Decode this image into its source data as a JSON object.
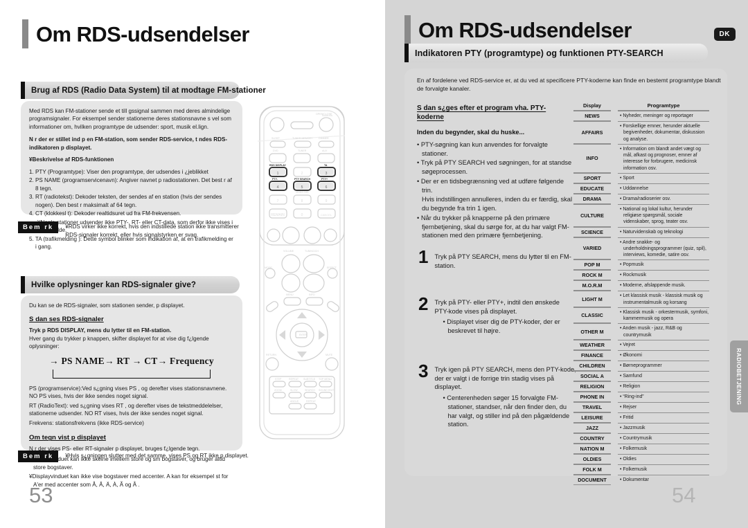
{
  "left_page": {
    "title": "Om RDS-udsendelser",
    "page_number": "53",
    "section1": {
      "heading": "Brug af RDS (Radio Data System) til at modtage FM-stationer",
      "intro": "Med RDS kan FM-stationer sende et till gssignal sammen med deres almindelige programsignaler. For eksempel sender stationerne deres stationsnavne s vel som informationer om, hvilken programtype de udsender: sport, musik el.lign.",
      "bold_note": "N r der er stillet ind p  en FM-station, som sender RDS-service, t ndes RDS-indikatoren p  displayet.",
      "sub_heading": "¥Beskrivelse af RDS-funktionen",
      "items": [
        "1. PTY (Programtype): Viser den programtype, der udsendes i ¿jeblikket",
        "2. PS NAME (programservicenavn): Angiver navnet p  radiostationen. Det best r af 8 tegn.",
        "3. RT (radiotekst): Dekoder teksten, der sendes af en station (hvis der sendes nogen). Den best r maksimalt af 64 tegn.",
        "4. CT (klokkesl t): Dekoder realtidsuret ud fra FM-frekvensen.",
        "¥Nogle stationer udsender ikke PTY-, RT- eller CT-data, som derfor ikke vises i alle tilf lde.",
        "5. TA (trafikmelding ): Dette symbol blinker som indikation af, at en trafikmelding er i gang."
      ],
      "note_badge": "Bem rk",
      "note_text": "¥RDS virker ikke korrekt, hvis den indstillede station ikke transmitterer RDS-signaler korrekt, eller hvis signalstyrken er svag."
    },
    "section2": {
      "heading": "Hvilke oplysninger kan RDS-signaler give?",
      "intro": "Du kan se de RDS-signaler, som stationen sender, p  displayet.",
      "sub1": "S dan ses RDS-signaler",
      "sub1_bold": "Tryk p  RDS DISPLAY, mens du lytter til en FM-station.",
      "sub1_text": "Hver gang du trykker p  knappen, skifter displayet for at vise dig f¿lgende oplysninger:",
      "flow": "→ PS NAME→  RT →  CT→  Frequency",
      "defs": [
        "PS (programservice):Ved s¿gning vises  PS , og derefter vises stationsnavnene. NO PS  vises, hvis der ikke sendes noget signal.",
        "RT (RadioText): ved s¿gning vises  RT , og derefter vises de tekstmeddelelser, stationerne udsender.  NO RT  vises, hvis der ikke sendes noget signal.",
        "Frekvens: stationsfrekvens (ikke RDS-service)"
      ],
      "sub2": "Om tegn vist p  displayet",
      "sub2_text": "N r der vises PS- eller RT-signaler p  displayet, bruges f¿lgende tegn.",
      "sub2_bullets": [
        "¥Displayvinduet kan ikke skelne imellem store og sm  bogstaver, og bruger altid store bogstaver.",
        "¥Displayvinduet kan ikke vise bogstaver med accenter.  A  kan for eksempel st  for  A'er  med accenter som  Å, Â, Ä, À, Ã og Å ."
      ],
      "note_badge": "Bem rk",
      "note_text": "¥Hvis s¿gningen slutter med det samme, vises  PS  og  RT  ikke p  displayet."
    }
  },
  "right_page": {
    "title": "Om RDS-udsendelser",
    "locale_badge": "DK",
    "page_number": "54",
    "side_tab": "RADIOBETJENING",
    "section_heading": "Indikatoren PTY (programtype) og funktionen PTY-SEARCH",
    "intro": "En af fordelene ved RDS-service er, at du ved at specificere PTY-koderne kan finde en bestemt programtype blandt de forvalgte kanaler.",
    "sub_heading": "S dan s¿ges efter et program vha. PTY-koderne",
    "remember_heading": "Inden du begynder, skal du huske...",
    "remember_bullets": [
      "• PTY-søgning kan kun anvendes for forvalgte stationer.",
      "• Tryk på PTY SEARCH ved søgningen, for at standse søgeprocessen.",
      "• Der er en tidsbegrænsning ved at udføre følgende trin.",
      "Hvis indstillingen annulleres, inden du er færdig, skal du begynde fra trin 1 igen.",
      "• Når du trykker på knapperne på den primære fjernbetjening, skal du sørge for, at du har valgt FM-stationen med den primære fjernbetjening."
    ],
    "steps": [
      {
        "num": "1",
        "text": "Tryk på PTY SEARCH, mens du lytter til en FM-station.",
        "bullets": []
      },
      {
        "num": "2",
        "text": "Tryk på PTY- eller PTY+, indtil den ønskede PTY-kode vises på displayet.",
        "bullets": [
          "• Displayet viser dig de PTY-koder, der er beskrevet til højre."
        ]
      },
      {
        "num": "3",
        "text": "Tryk igen på PTY SEARCH, mens den PTY-kode, der er valgt i de forrige trin stadig vises på displayet.",
        "bullets": [
          "• Centerenheden søger 15 forvalgte FM-stationer, standser, når den finder den, du har valgt, og stiller ind på den pågældende station."
        ]
      }
    ],
    "pty_table": {
      "columns": [
        "Display",
        "Programtype"
      ],
      "rows": [
        {
          "display": "NEWS",
          "desc": "• Nyheder, meninger og reportager"
        },
        {
          "display": "AFFAIRS",
          "desc": "• Forskellige emner, herunder aktuelle begivenheder, dokumentar, diskussion og analyse."
        },
        {
          "display": "INFO",
          "desc": "• Information om blandt andet vægt og mål, afkast og prognoser, emner af interesse for forbrugere, medicinsk information osv."
        },
        {
          "display": "SPORT",
          "desc": "• Sport"
        },
        {
          "display": "EDUCATE",
          "desc": "• Uddannelse"
        },
        {
          "display": "DRAMA",
          "desc": "• Drama/radioserier osv."
        },
        {
          "display": "CULTURE",
          "desc": "• National og lokal kultur, herunder religiøse spørgsmål, sociale videnskaber, sprog, teater osv."
        },
        {
          "display": "SCIENCE",
          "desc": "• Naturvidenskab og teknologi"
        },
        {
          "display": "VARIED",
          "desc": "• Andre snakke- og underholdningsprogrammer (quiz, spil), interviews, komedie, satire osv."
        },
        {
          "display": "POP M",
          "desc": "• Popmusik"
        },
        {
          "display": "ROCK M",
          "desc": "• Rockmusik"
        },
        {
          "display": "M.O.R.M",
          "desc": "• Moderne, afslappende musik."
        },
        {
          "display": "LIGHT M",
          "desc": "• Let klassisk musik - klassisk musik og instrumentalmusik og korsang"
        },
        {
          "display": "CLASSIC",
          "desc": "• Klassisk musik - orkestermusik, symfoni, kammermusik og opera"
        },
        {
          "display": "OTHER M",
          "desc": "• Anden musik - jazz, R&B og countrymusik"
        },
        {
          "display": "WEATHER",
          "desc": "• Vejret"
        },
        {
          "display": "FINANCE",
          "desc": "• Økonomi"
        },
        {
          "display": "CHILDREN",
          "desc": "• Børneprogrammer"
        },
        {
          "display": "SOCIAL A",
          "desc": "• Samfund"
        },
        {
          "display": "RELIGION",
          "desc": "• Religion"
        },
        {
          "display": "PHONE IN",
          "desc": "• “Ring-ind”"
        },
        {
          "display": "TRAVEL",
          "desc": "• Rejser"
        },
        {
          "display": "LEISURE",
          "desc": "• Fritid"
        },
        {
          "display": "JAZZ",
          "desc": "• Jazzmusik"
        },
        {
          "display": "COUNTRY",
          "desc": "• Countrymusik"
        },
        {
          "display": "NATION M",
          "desc": "• Folkemusik"
        },
        {
          "display": "OLDIES",
          "desc": "• Oldies"
        },
        {
          "display": "FOLK M",
          "desc": "• Folkemusik"
        },
        {
          "display": "DOCUMENT",
          "desc": "• Dokumentar"
        }
      ]
    }
  },
  "remote": {
    "name": "remote-control-illustration",
    "labels": {
      "open_close": "OPEN/CLOSE",
      "sleep": "SLEEP",
      "tuner_memory": "TUNER MEMORY",
      "program": "PRGM",
      "dimmer": "DIMMER",
      "dvd": "DVD",
      "tuner": "TUNER",
      "aux": "AUX",
      "rds_display": "RDS DISPLAY",
      "ta": "TA",
      "pty_minus": "PTY-",
      "pty_search": "PTY SEARCH",
      "pty_plus": "PTY+",
      "remain": "REMAIN",
      "video_sel": "VIDEO SEL",
      "cancel": "CANCEL",
      "volume": "VOLUME",
      "tuning": "TUNING/CH",
      "mode": "MODE",
      "effect": "EFFECT",
      "menu": "MENU",
      "info": "INFO",
      "enter": "ENTER",
      "return": "RETURN",
      "mute": "MUTE",
      "step": "STEP",
      "repeat": "REPEAT",
      "subtitle": "SUBTITLE",
      "top_menu": "TOP MENU",
      "zoom": "ZOOM",
      "slow": "SLOW",
      "sound_edit": "SOUND EDIT",
      "angle": "ANGLE",
      "search": "SEARCH",
      "logo": "SAMSUNG"
    },
    "highlighted_buttons": [
      "RDS DISPLAY",
      "TA",
      "PTY-",
      "PTY SEARCH",
      "PTY+"
    ],
    "number_keys": [
      "1",
      "2",
      "3",
      "4",
      "5",
      "6",
      "7",
      "8",
      "9",
      "0"
    ]
  }
}
